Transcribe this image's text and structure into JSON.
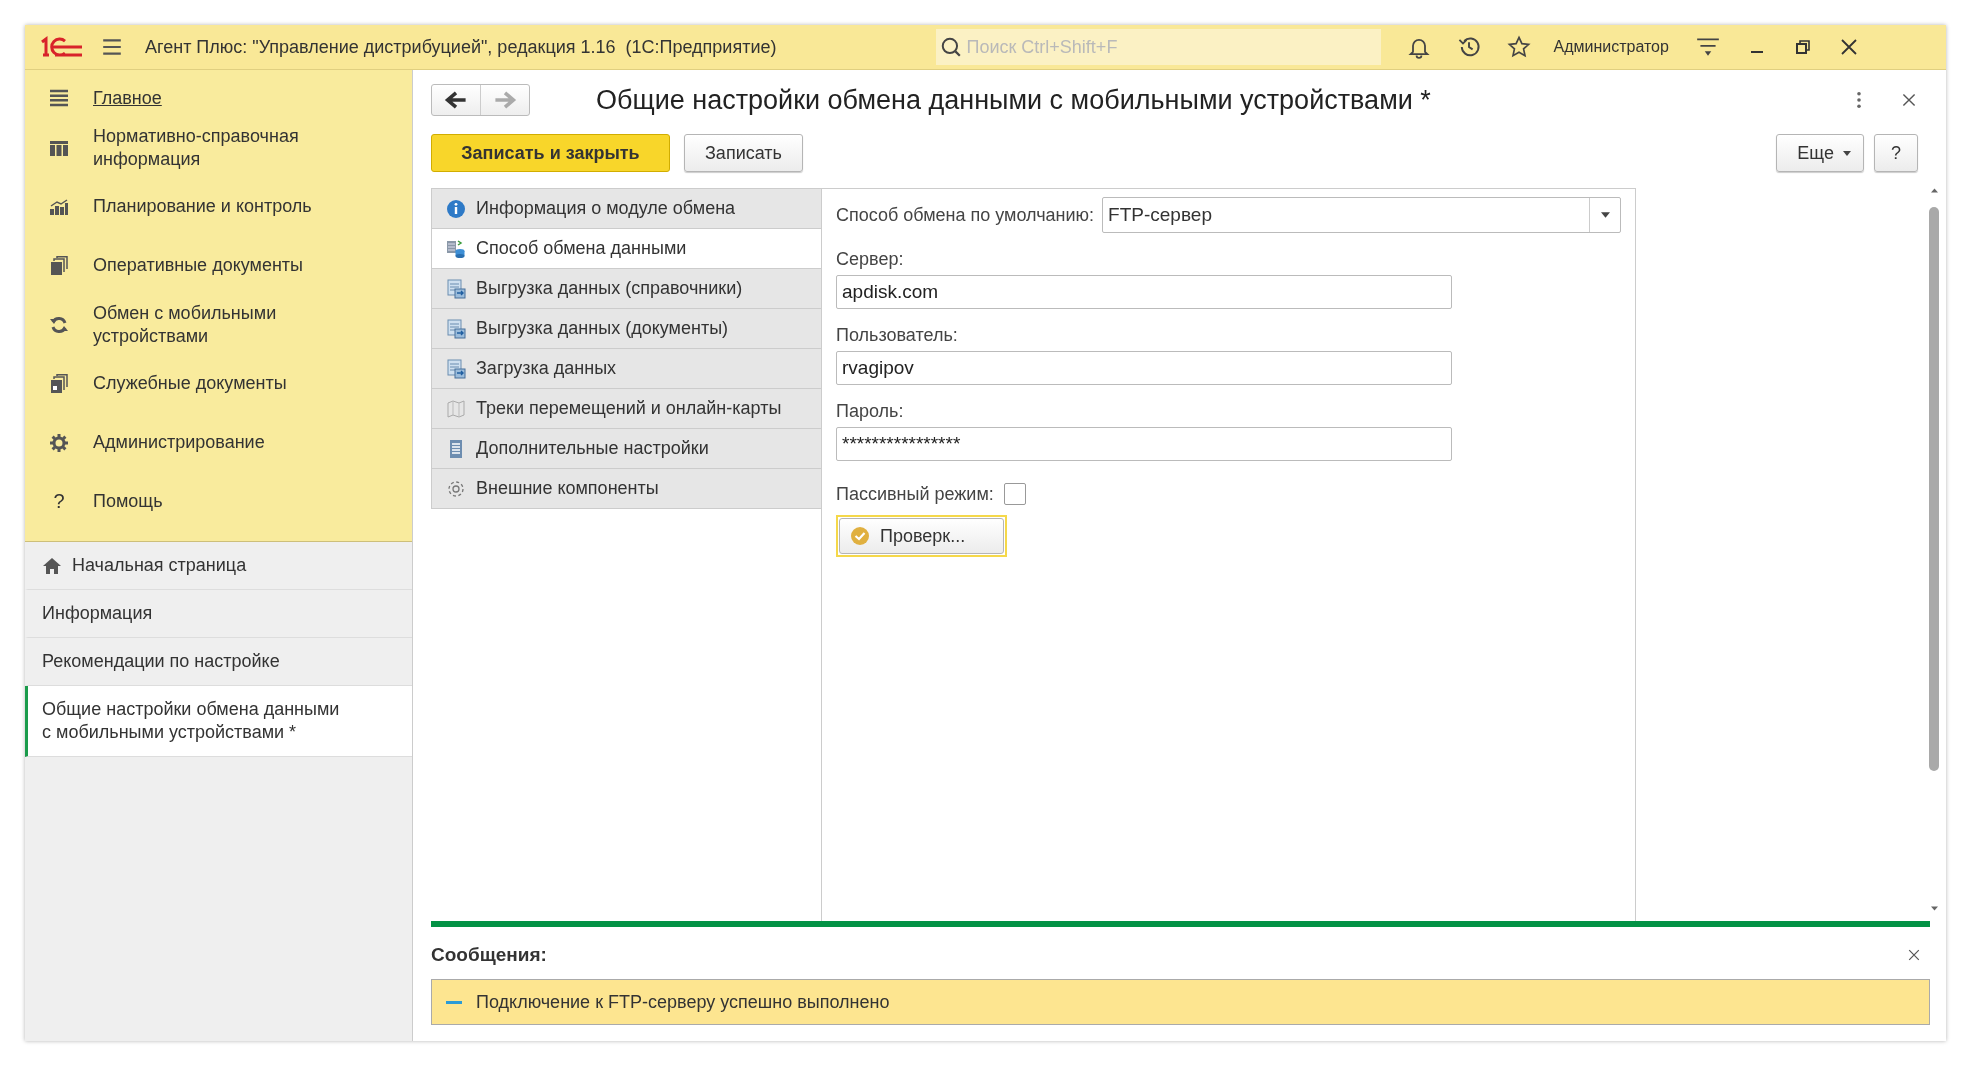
{
  "window": {
    "title": "Агент Плюс: \"Управление дистрибуцией\", редакция 1.16  (1С:Предприятие)",
    "search": {
      "placeholder": "Поиск Ctrl+Shift+F"
    },
    "user": "Администратор"
  },
  "sidebar": {
    "sections": [
      {
        "label": "Главное",
        "kind": "menu"
      },
      {
        "label": "Нормативно-справочная информация",
        "kind": "columns"
      },
      {
        "label": "Планирование и контроль",
        "kind": "chart"
      },
      {
        "label": "Оперативные документы",
        "kind": "docs"
      },
      {
        "label": "Обмен с мобильными устройствами",
        "kind": "sync"
      },
      {
        "label": "Служебные документы",
        "kind": "service"
      },
      {
        "label": "Администрирование",
        "kind": "gear"
      },
      {
        "label": "Помощь",
        "kind": "help",
        "icon": "?"
      }
    ],
    "open_windows": [
      {
        "label": "Начальная страница",
        "kind": "home",
        "selected": false
      },
      {
        "label": "Информация",
        "kind": "plain",
        "selected": false
      },
      {
        "label": "Рекомендации по настройке",
        "kind": "plain",
        "selected": false
      },
      {
        "label": "Общие настройки обмена данными с мобильными устройствами *",
        "kind": "plain",
        "selected": true
      }
    ]
  },
  "form": {
    "title": "Общие настройки обмена данными с мобильными устройствами *",
    "buttons": [
      {
        "label": "Записать и закрыть",
        "kind": "primary"
      },
      {
        "label": "Записать",
        "kind": "normal"
      }
    ],
    "more_button": "Еще",
    "help_button": "?",
    "tabs": [
      {
        "label": "Информация о модуле обмена",
        "kind": "info",
        "selected": false
      },
      {
        "label": "Способ обмена данными",
        "kind": "exchange",
        "selected": true
      },
      {
        "label": "Выгрузка данных (справочники)",
        "kind": "upload",
        "selected": false
      },
      {
        "label": "Выгрузка данных (документы)",
        "kind": "upload",
        "selected": false
      },
      {
        "label": "Загрузка данных",
        "kind": "upload",
        "selected": false
      },
      {
        "label": "Треки перемещений и онлайн-карты",
        "kind": "map",
        "selected": false
      },
      {
        "label": "Дополнительные настройки",
        "kind": "list",
        "selected": false
      },
      {
        "label": "Внешние компоненты",
        "kind": "gear",
        "selected": false
      }
    ],
    "exchange_method": {
      "label": "Способ обмена по умолчанию:",
      "value": "FTP-сервер"
    },
    "fields": [
      {
        "label": "Сервер:",
        "value": "apdisk.com"
      },
      {
        "label": "Пользователь:",
        "value": "rvagipov"
      },
      {
        "label": "Пароль:",
        "value": "****************"
      }
    ],
    "passive_mode": {
      "label": "Пассивный режим:",
      "checked": false
    },
    "check_button": "Проверк..."
  },
  "messages": {
    "title": "Сообщения:",
    "items": [
      {
        "text": "Подключение к FTP-серверу успешно выполнено"
      }
    ]
  }
}
